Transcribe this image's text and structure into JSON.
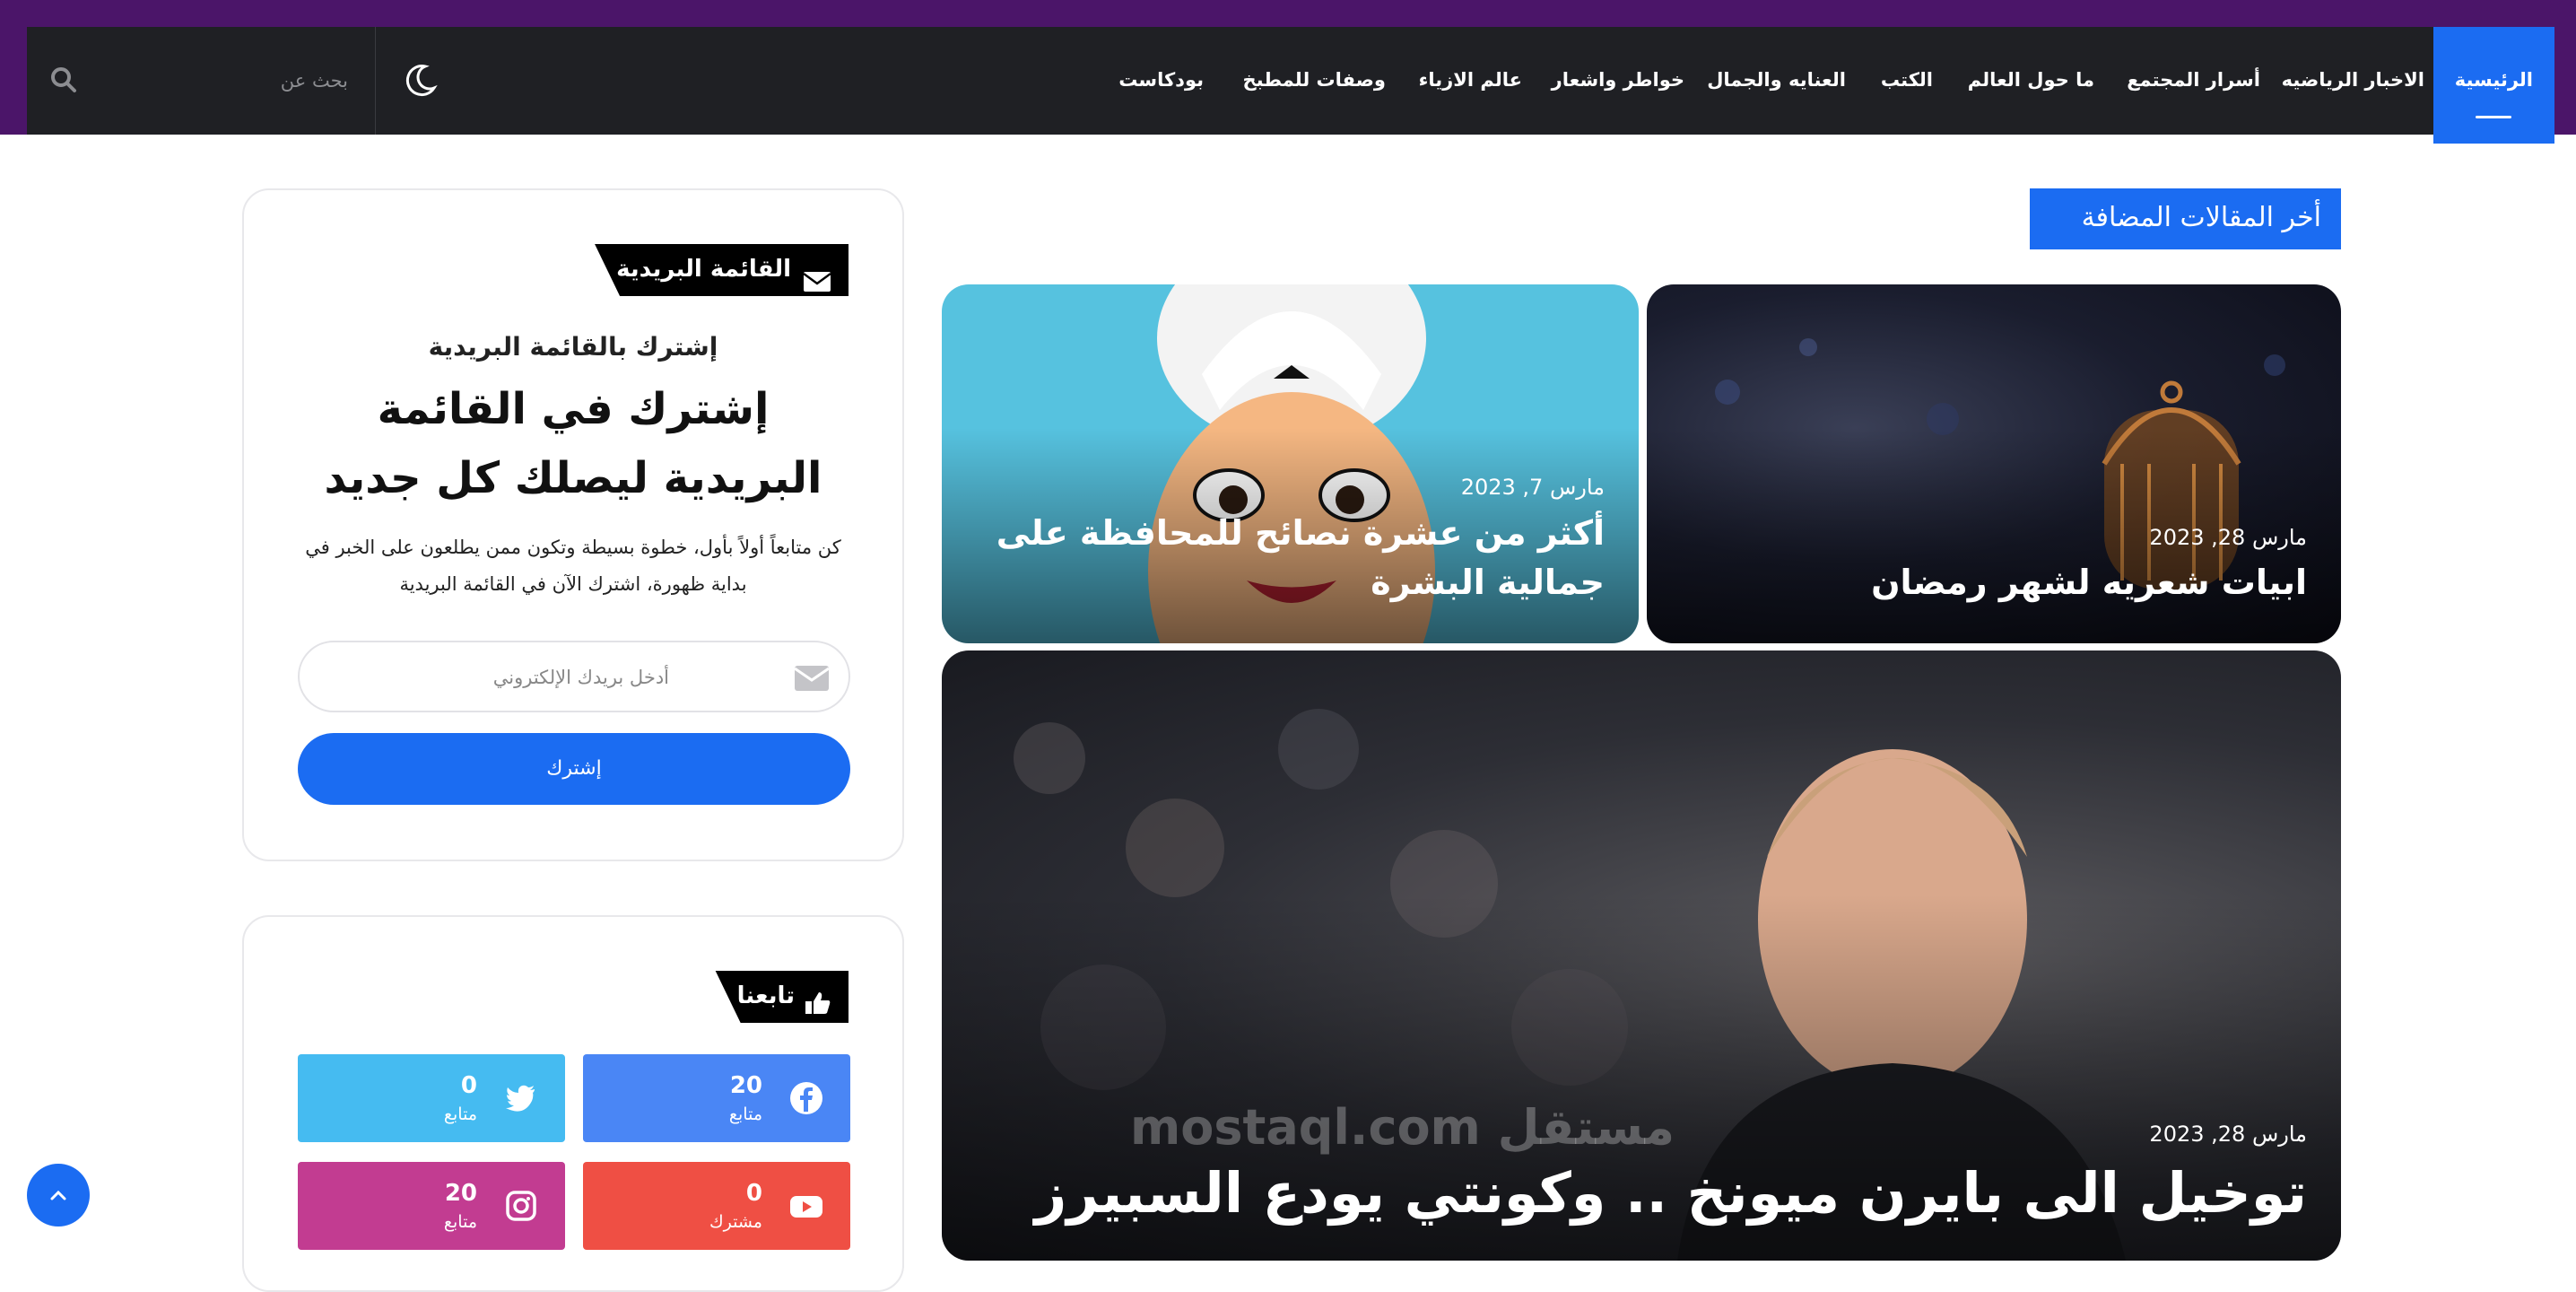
{
  "nav": {
    "items": [
      {
        "label": "الرئيسية",
        "active": true
      },
      {
        "label": "الاخبار الرياضيه"
      },
      {
        "label": "أسرار المجتمع"
      },
      {
        "label": "ما حول العالم"
      },
      {
        "label": "الكتب"
      },
      {
        "label": "العنايه والجمال"
      },
      {
        "label": "خواطر واشعار"
      },
      {
        "label": "عالم الازياء"
      },
      {
        "label": "وصفات للمطبخ"
      },
      {
        "label": "بودكاست"
      }
    ],
    "search_placeholder": "بحث عن"
  },
  "latest": {
    "heading": "أخر المقالات المضافة",
    "posts": [
      {
        "date": "مارس 28, 2023",
        "title": "ابيات شعريه لشهر رمضان"
      },
      {
        "date": "مارس 7, 2023",
        "title": "أكثر من عشرة نصائح للمحافظة على جمالية البشرة"
      },
      {
        "date": "مارس 28, 2023",
        "title": "توخيل الى بايرن ميونخ .. وكونتي يودع السبيرز"
      }
    ]
  },
  "newsletter": {
    "heading": "القائمة البريدية",
    "subtitle": "إشترك بالقائمة البريدية",
    "title": "إشترك في القائمة البريدية ليصلك كل جديد",
    "description": "كن متابعاً أولاً بأول، خطوة بسيطة وتكون ممن يطلعون على الخبر في بداية ظهورة، اشترك الآن في القائمة البريدية",
    "email_placeholder": "أدخل بريدك الإلكتروني",
    "button": "إشترك"
  },
  "follow": {
    "heading": "تابعنا",
    "items": [
      {
        "network": "facebook",
        "count": "20",
        "label": "متابع",
        "color": "#4a86f5"
      },
      {
        "network": "twitter",
        "count": "0",
        "label": "متابع",
        "color": "#45bbf1"
      },
      {
        "network": "youtube",
        "count": "0",
        "label": "مشترك",
        "color": "#ef4f44"
      },
      {
        "network": "instagram",
        "count": "20",
        "label": "متابع",
        "color": "#c23c91"
      }
    ]
  },
  "watermark": "مستقل mostaql.com",
  "icons": [
    "search-icon",
    "moon-icon",
    "envelope-icon",
    "thumbs-up-icon",
    "facebook-icon",
    "twitter-icon",
    "youtube-icon",
    "instagram-icon",
    "chevron-up-icon"
  ]
}
